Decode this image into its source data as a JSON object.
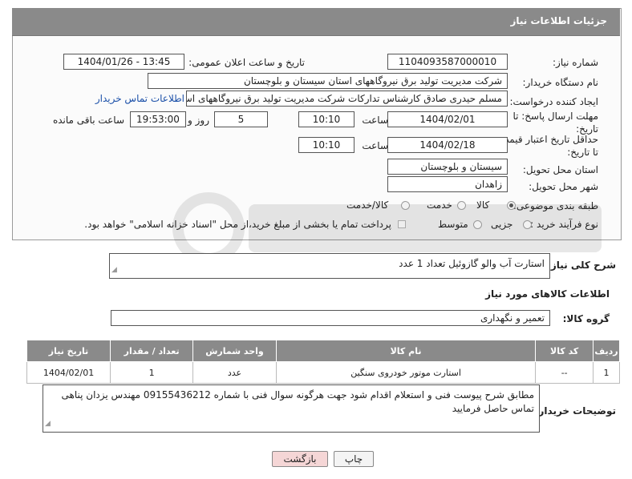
{
  "header": {
    "title": "جزئیات اطلاعات نیاز"
  },
  "fields": {
    "need_number_label": "شماره نیاز:",
    "need_number": "1104093587000010",
    "announce_label": "تاریخ و ساعت اعلان عمومی:",
    "announce_value": "1404/01/26 - 13:45",
    "buyer_org_label": "نام دستگاه خریدار:",
    "buyer_org": "شرکت مدیریت تولید برق نیروگاههای استان سیستان و بلوچستان",
    "creator_label": "ایجاد کننده درخواست:",
    "creator": "مسلم حیدری صادق کارشناس تدارکات شرکت مدیریت تولید برق نیروگاههای اس",
    "contact_link": "اطلاعات تماس خریدار",
    "deadline_label": "مهلت ارسال پاسخ: تا تاریخ:",
    "deadline_date": "1404/02/01",
    "time_label": "ساعت",
    "deadline_time": "10:10",
    "days_value": "5",
    "days_label": "روز و",
    "remaining_time": "19:53:00",
    "remaining_label": "ساعت باقی مانده",
    "validity_label": "حداقل تاریخ اعتبار قیمت: تا تاریخ:",
    "validity_date": "1404/02/18",
    "validity_time": "10:10",
    "province_label": "استان محل تحویل:",
    "province": "سیستان و بلوچستان",
    "city_label": "شهر محل تحویل:",
    "city": "زاهدان",
    "category_label": "طبقه بندی موضوعی:",
    "category_options": [
      "کالا",
      "خدمت",
      "کالا/خدمت"
    ],
    "process_label": "نوع فرآیند خرید :",
    "process_options": [
      "جزیی",
      "متوسط"
    ],
    "payment_note": "پرداخت تمام یا بخشی از مبلغ خرید،از محل \"اسناد خزانه اسلامی\" خواهد بود."
  },
  "summary": {
    "label": "شرح کلی نیاز:",
    "text": "استارت آب والو  گازوئیل تعداد  1 عدد"
  },
  "goods": {
    "section_title": "اطلاعات کالاهای مورد نیاز",
    "group_label": "گروه کالا:",
    "group_value": "تعمیر و نگهداری",
    "columns": [
      "ردیف",
      "کد کالا",
      "نام کالا",
      "واحد شمارش",
      "تعداد / مقدار",
      "تاریخ نیاز"
    ],
    "rows": [
      {
        "row": "1",
        "code": "--",
        "name": "استارت موتور خودروی سنگین",
        "unit": "عدد",
        "qty": "1",
        "date": "1404/02/01"
      }
    ]
  },
  "buyer_notes": {
    "label": "توضیحات خریدار:",
    "text": "مطابق شرح پیوست  فنی و استعلام اقدام شود جهت هرگونه سوال فنی با شماره 09155436212 مهندس یزدان پناهی تماس حاصل فرمایید"
  },
  "buttons": {
    "print": "چاپ",
    "back": "بازگشت"
  },
  "colors": {
    "header_bg": "#8a8a8a",
    "back_button_bg": "#f5d6d6",
    "link": "#1a4fa8"
  }
}
